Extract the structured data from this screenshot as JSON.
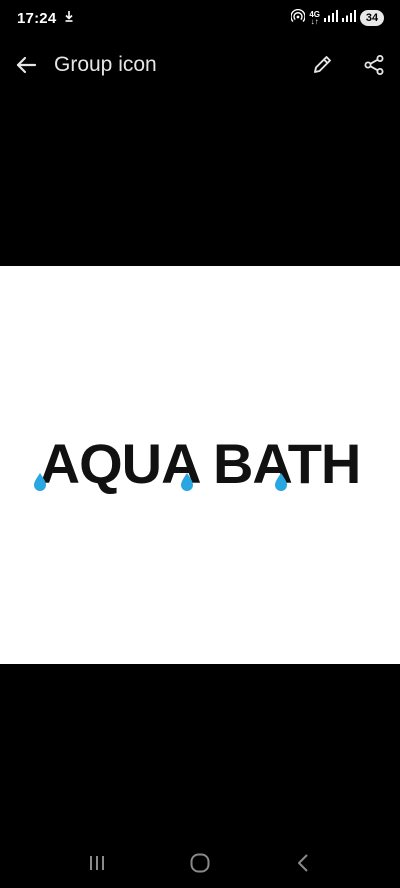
{
  "status_bar": {
    "time": "17:24",
    "network_top": "4G",
    "network_bottom": "↓↑",
    "battery": "34"
  },
  "app_bar": {
    "title": "Group icon"
  },
  "image": {
    "logo_text": "AQUA BATH"
  },
  "colors": {
    "background": "#000000",
    "image_background": "#ffffff",
    "logo_text": "#111111",
    "water_drop": "#2aa7e0"
  }
}
